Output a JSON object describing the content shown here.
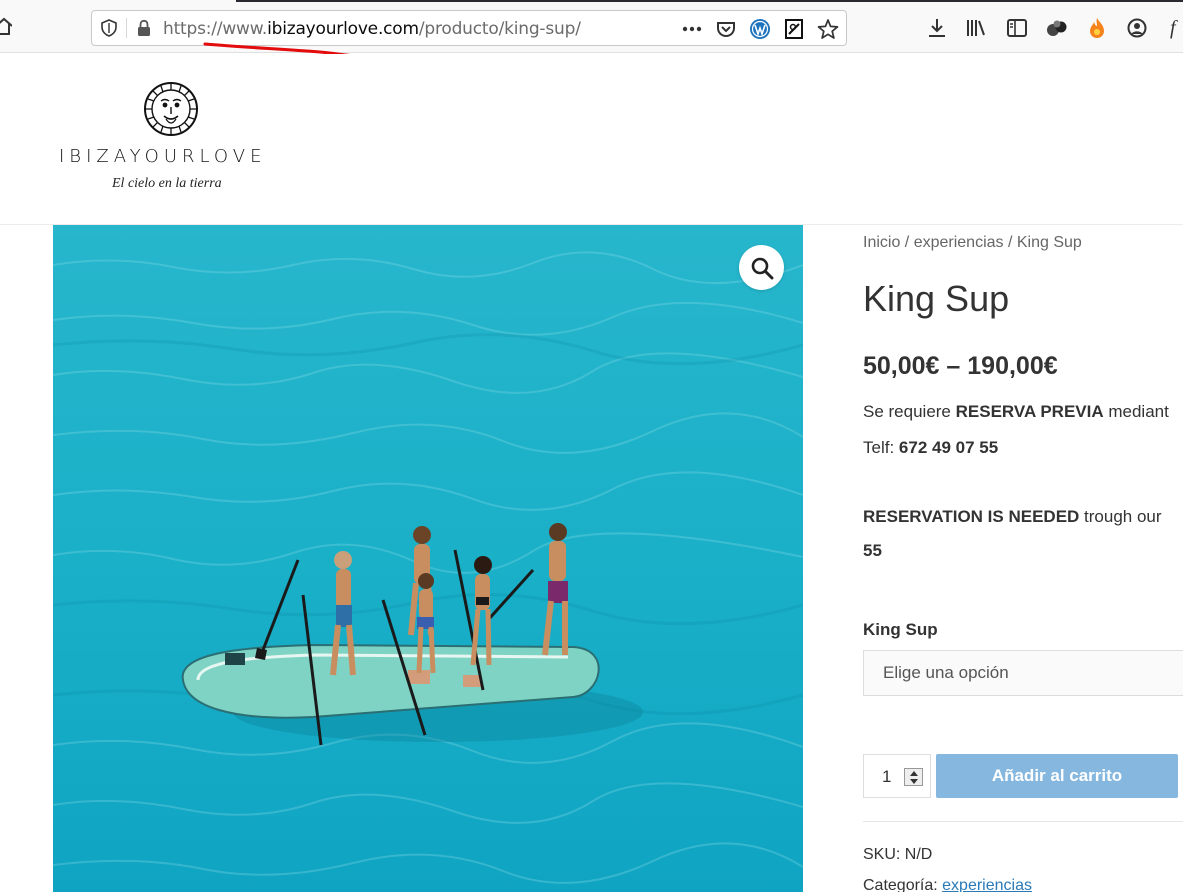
{
  "browser": {
    "url_prefix": "https://www.",
    "url_domain": "ibizayourlove.com",
    "url_path": "/producto/king-sup/",
    "icons": [
      "home-icon",
      "shield-icon",
      "lock-icon",
      "more-icon",
      "pocket-icon",
      "wordpress-icon",
      "reader-icon",
      "star-icon",
      "download-icon",
      "library-icon",
      "sidebar-icon",
      "extension-icon",
      "fire-icon",
      "account-icon",
      "font-icon"
    ]
  },
  "site": {
    "name": "IBIZAYOURLOVE",
    "tagline": "El cielo en la tierra"
  },
  "breadcrumb": {
    "home": "Inicio",
    "sep1": " / ",
    "category": "experiencias",
    "sep2": " / ",
    "current": "King Sup"
  },
  "product": {
    "title": "King Sup",
    "price": "50,00€ – 190,00€",
    "desc1_pre": "Se requiere ",
    "desc1_bold": "RESERVA PREVIA",
    "desc1_post": " mediant",
    "desc2_pre": "Telf: ",
    "desc2_bold": "672 49 07 55",
    "desc3_bold": "RESERVATION IS NEEDED",
    "desc3_post": " trough our",
    "desc4_bold": "55",
    "variation_label": "King Sup",
    "variation_placeholder": "Elige una opción",
    "quantity": "1",
    "add_to_cart": "Añadir al carrito",
    "sku_label": "SKU: ",
    "sku_value": "N/D",
    "category_label": "Categoría: ",
    "category_value": "experiencias"
  },
  "colors": {
    "accent_button": "#86b7de",
    "link": "#2a7ab8",
    "sea": "#1fb3c9",
    "annotation": "#e30b0b"
  }
}
